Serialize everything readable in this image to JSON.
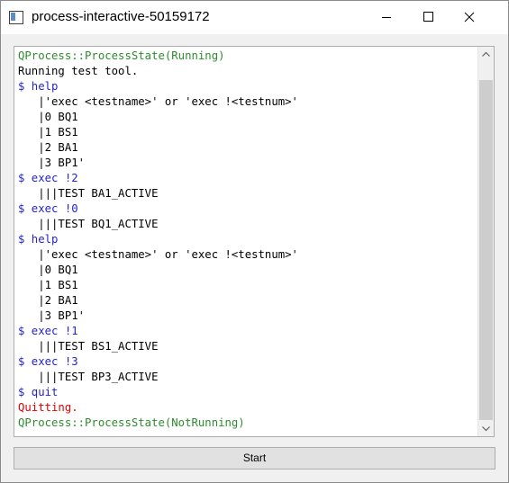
{
  "window": {
    "title": "process-interactive-50159172",
    "controls": {
      "minimize_icon": "minimize-icon",
      "maximize_icon": "maximize-icon",
      "close_icon": "close-icon"
    }
  },
  "console": {
    "lines": [
      {
        "text": "QProcess::ProcessState(Running)",
        "color": "#2e8b2e"
      },
      {
        "text": "Running test tool.",
        "color": "#000000"
      },
      {
        "text": "$ help",
        "color": "#2424c8"
      },
      {
        "text": "   |'exec <testname>' or 'exec !<testnum>'",
        "color": "#000000"
      },
      {
        "text": "   |0 BQ1",
        "color": "#000000"
      },
      {
        "text": "   |1 BS1",
        "color": "#000000"
      },
      {
        "text": "   |2 BA1",
        "color": "#000000"
      },
      {
        "text": "   |3 BP1'",
        "color": "#000000"
      },
      {
        "text": "$ exec !2",
        "color": "#2424c8"
      },
      {
        "text": "   |||TEST BA1_ACTIVE",
        "color": "#000000"
      },
      {
        "text": "$ exec !0",
        "color": "#2424c8"
      },
      {
        "text": "   |||TEST BQ1_ACTIVE",
        "color": "#000000"
      },
      {
        "text": "$ help",
        "color": "#2424c8"
      },
      {
        "text": "   |'exec <testname>' or 'exec !<testnum>'",
        "color": "#000000"
      },
      {
        "text": "   |0 BQ1",
        "color": "#000000"
      },
      {
        "text": "   |1 BS1",
        "color": "#000000"
      },
      {
        "text": "   |2 BA1",
        "color": "#000000"
      },
      {
        "text": "   |3 BP1'",
        "color": "#000000"
      },
      {
        "text": "$ exec !1",
        "color": "#2424c8"
      },
      {
        "text": "   |||TEST BS1_ACTIVE",
        "color": "#000000"
      },
      {
        "text": "$ exec !3",
        "color": "#2424c8"
      },
      {
        "text": "   |||TEST BP3_ACTIVE",
        "color": "#000000"
      },
      {
        "text": "$ quit",
        "color": "#2424c8"
      },
      {
        "text": "Quitting.",
        "color": "#e00000"
      },
      {
        "text": "QProcess::ProcessState(NotRunning)",
        "color": "#2e8b2e"
      }
    ]
  },
  "footer": {
    "start_label": "Start"
  },
  "colors": {
    "running_state": "#2e8b2e",
    "command": "#2424c8",
    "error": "#e00000",
    "output": "#000000"
  }
}
